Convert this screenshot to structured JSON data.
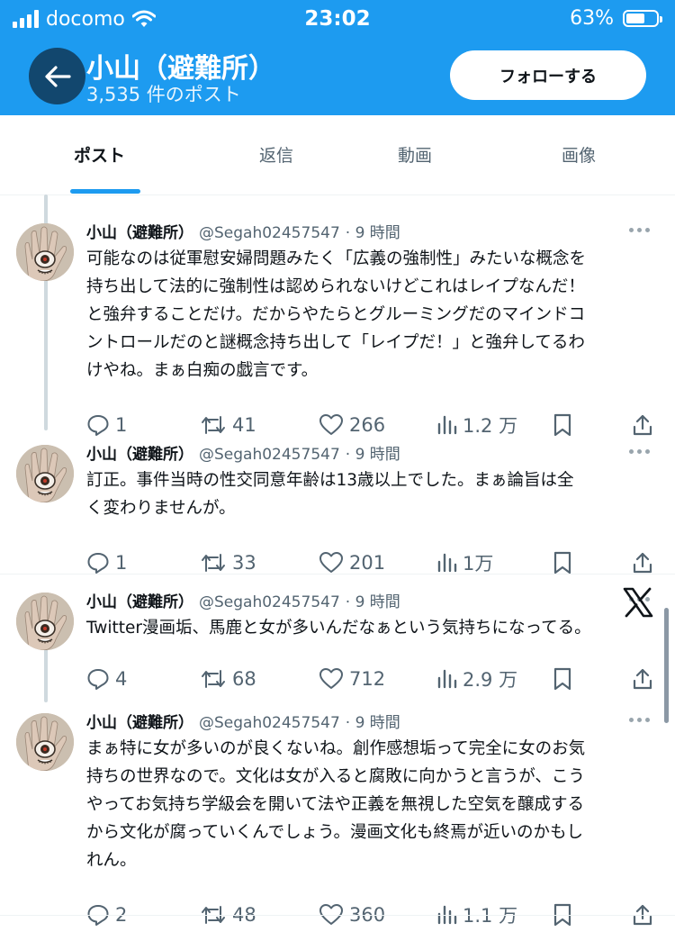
{
  "status": {
    "carrier": "docomo",
    "time": "23:02",
    "battery": "63%",
    "battery_level": 0.63
  },
  "header": {
    "name": "小山（避難所）",
    "post_count": "3,535 件のポスト",
    "follow_label": "フォローする"
  },
  "tabs": [
    {
      "label": "ポスト",
      "active": true
    },
    {
      "label": "返信",
      "active": false
    },
    {
      "label": "動画",
      "active": false
    },
    {
      "label": "画像",
      "active": false
    }
  ],
  "tweets": [
    {
      "name": "小山（避難所）",
      "handle": "@Segah02457547",
      "time": "· 9 時間",
      "lines": [
        "可能なのは従軍慰安婦問題みたく「広義の強制性」みたいな概念を",
        "持ち出して法的に強制性は認められないけどこれはレイプなんだ！",
        "と強弁することだけ。だからやたらとグルーミングだのマインドコ",
        "ントロールだのと謎概念持ち出して「レイプだ！」と強弁してるわ",
        "けやね。まぁ白痴の戯言です。"
      ],
      "replies": "1",
      "reposts": "41",
      "likes": "266",
      "views": "1.2 万"
    },
    {
      "name": "小山（避難所）",
      "handle": "@Segah02457547",
      "time": "· 9 時間",
      "lines": [
        "訂正。事件当時の性交同意年齢は13歳以上でした。まぁ論旨は全",
        "く変わりませんが。"
      ],
      "replies": "1",
      "reposts": "33",
      "likes": "201",
      "views": "1万"
    },
    {
      "name": "小山（避難所）",
      "handle": "@Segah02457547",
      "time": "· 9 時間",
      "lines": [
        "Twitter漫画垢、馬鹿と女が多いんだなぁという気持ちになってる。"
      ],
      "replies": "4",
      "reposts": "68",
      "likes": "712",
      "views": "2.9 万"
    },
    {
      "name": "小山（避難所）",
      "handle": "@Segah02457547",
      "time": "· 9 時間",
      "lines": [
        "まぁ特に女が多いのが良くないね。創作感想垢って完全に女のお気",
        "持ちの世界なので。文化は女が入ると腐敗に向かうと言うが、こう",
        "やってお気持ち学級会を開いて法や正義を無視した空気を醸成する",
        "から文化が腐っていくんでしょう。漫画文化も終焉が近いのかもし",
        "れん。"
      ],
      "replies": "2",
      "reposts": "48",
      "likes": "360",
      "views": "1.1 万"
    }
  ]
}
